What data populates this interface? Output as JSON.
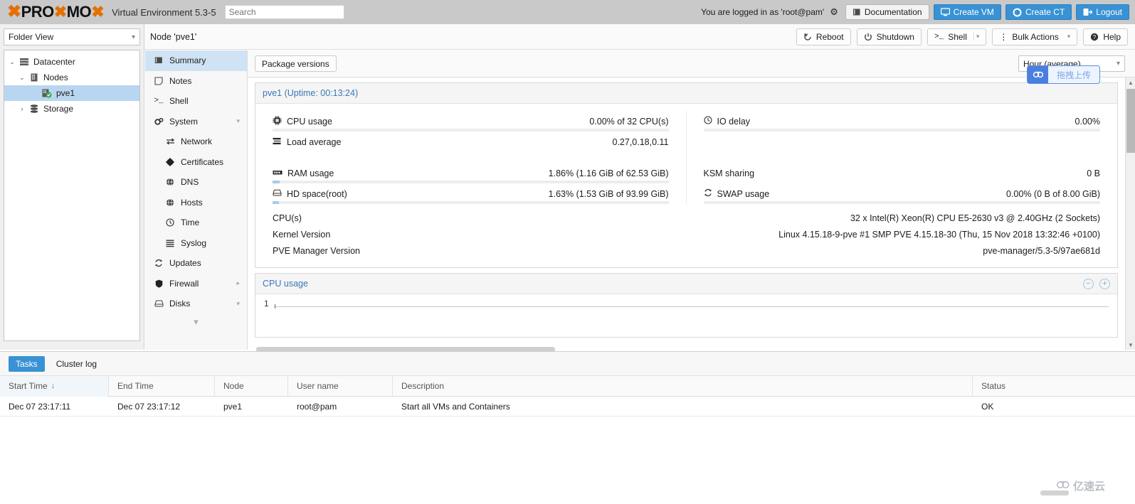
{
  "header": {
    "brand": "PROXMOX",
    "product": "Virtual Environment 5.3-5",
    "search_placeholder": "Search",
    "search_value": "",
    "login_text": "You are logged in as 'root@pam'",
    "gear_icon": "gear-icon",
    "buttons": [
      {
        "label": "Documentation",
        "icon": "book-icon",
        "style": "light"
      },
      {
        "label": "Create VM",
        "icon": "monitor-icon",
        "style": "blue"
      },
      {
        "label": "Create CT",
        "icon": "container-icon",
        "style": "blue"
      },
      {
        "label": "Logout",
        "icon": "logout-icon",
        "style": "blue"
      }
    ]
  },
  "node_toolbar": {
    "title": "Node 'pve1'",
    "buttons": [
      {
        "label": "Reboot",
        "icon": "reboot-icon",
        "caret": false
      },
      {
        "label": "Shutdown",
        "icon": "power-icon",
        "caret": false
      },
      {
        "label": "Shell",
        "icon": "terminal-icon",
        "caret": true
      },
      {
        "label": "Bulk Actions",
        "icon": "vertical-dots-icon",
        "caret": true
      },
      {
        "label": "Help",
        "icon": "help-icon",
        "caret": false
      }
    ]
  },
  "sidebar": {
    "view_selector": "Folder View",
    "tree": [
      {
        "label": "Datacenter",
        "icon": "datacenter-icon",
        "indent": 0,
        "expander": "⌄",
        "selected": false
      },
      {
        "label": "Nodes",
        "icon": "nodes-icon",
        "indent": 1,
        "expander": "⌄",
        "selected": false
      },
      {
        "label": "pve1",
        "icon": "node-online-icon",
        "indent": 2,
        "expander": "",
        "selected": true
      },
      {
        "label": "Storage",
        "icon": "storage-icon",
        "indent": 1,
        "expander": "›",
        "selected": false
      }
    ]
  },
  "navmenu": {
    "items": [
      {
        "label": "Summary",
        "icon": "summary-icon",
        "sub": false,
        "arrow": "",
        "selected": true
      },
      {
        "label": "Notes",
        "icon": "notes-icon",
        "sub": false,
        "arrow": "",
        "selected": false
      },
      {
        "label": "Shell",
        "icon": "shell-icon",
        "sub": false,
        "arrow": "",
        "selected": false
      },
      {
        "label": "System",
        "icon": "system-icon",
        "sub": false,
        "arrow": "▾",
        "selected": false
      },
      {
        "label": "Network",
        "icon": "network-icon",
        "sub": true,
        "arrow": "",
        "selected": false
      },
      {
        "label": "Certificates",
        "icon": "certificate-icon",
        "sub": true,
        "arrow": "",
        "selected": false
      },
      {
        "label": "DNS",
        "icon": "dns-icon",
        "sub": true,
        "arrow": "",
        "selected": false
      },
      {
        "label": "Hosts",
        "icon": "hosts-icon",
        "sub": true,
        "arrow": "",
        "selected": false
      },
      {
        "label": "Time",
        "icon": "clock-icon",
        "sub": true,
        "arrow": "",
        "selected": false
      },
      {
        "label": "Syslog",
        "icon": "syslog-icon",
        "sub": true,
        "arrow": "",
        "selected": false
      },
      {
        "label": "Updates",
        "icon": "updates-icon",
        "sub": false,
        "arrow": "",
        "selected": false
      },
      {
        "label": "Firewall",
        "icon": "firewall-icon",
        "sub": false,
        "arrow": "▸",
        "selected": false
      },
      {
        "label": "Disks",
        "icon": "disks-icon",
        "sub": false,
        "arrow": "▾",
        "selected": false
      }
    ],
    "more_icon": "chevron-down-icon"
  },
  "main": {
    "package_versions_label": "Package versions",
    "time_range": "Hour (average)",
    "summary_panel_title": "pve1 (Uptime: 00:13:24)",
    "stats_left": [
      {
        "label": "CPU usage",
        "icon": "cpu-icon",
        "value": "0.00% of 32 CPU(s)",
        "bar_pct": 0,
        "has_bar": true
      },
      {
        "label": "Load average",
        "icon": "load-icon",
        "value": "0.27,0.18,0.11",
        "bar_pct": null,
        "has_bar": false
      },
      {
        "label": "RAM usage",
        "icon": "ram-icon",
        "value": "1.86% (1.16 GiB of 62.53 GiB)",
        "bar_pct": 1.86,
        "has_bar": true
      },
      {
        "label": "HD space(root)",
        "icon": "hd-icon",
        "value": "1.63% (1.53 GiB of 93.99 GiB)",
        "bar_pct": 1.63,
        "has_bar": true
      }
    ],
    "stats_right": [
      {
        "label": "IO delay",
        "icon": "iodelay-icon",
        "value": "0.00%",
        "bar_pct": 0,
        "has_bar": true
      },
      {
        "label": "KSM sharing",
        "icon": "",
        "value": "0 B",
        "bar_pct": null,
        "has_bar": false
      },
      {
        "label": "SWAP usage",
        "icon": "swap-icon",
        "value": "0.00% (0 B of 8.00 GiB)",
        "bar_pct": 0,
        "has_bar": true
      }
    ],
    "info_rows": [
      {
        "label": "CPU(s)",
        "value": "32 x Intel(R) Xeon(R) CPU E5-2630 v3 @ 2.40GHz (2 Sockets)"
      },
      {
        "label": "Kernel Version",
        "value": "Linux 4.15.18-9-pve #1 SMP PVE 4.15.18-30 (Thu, 15 Nov 2018 13:32:46 +0100)"
      },
      {
        "label": "PVE Manager Version",
        "value": "pve-manager/5.3-5/97ae681d"
      }
    ],
    "cpu_chart": {
      "title": "CPU usage",
      "y_top_label": "1",
      "zoom_out_icon": "minus-circle-icon",
      "zoom_in_icon": "plus-circle-icon"
    }
  },
  "upload_widget": {
    "label": "拖拽上传",
    "icon": "cloud-upload-icon"
  },
  "bottom": {
    "tabs": [
      {
        "label": "Tasks",
        "active": true
      },
      {
        "label": "Cluster log",
        "active": false
      }
    ],
    "columns": [
      "Start Time",
      "End Time",
      "Node",
      "User name",
      "Description",
      "Status"
    ],
    "sorted_column": 0,
    "sort_arrow": "↓",
    "rows": [
      {
        "start_time": "Dec 07 23:17:11",
        "end_time": "Dec 07 23:17:12",
        "node": "pve1",
        "user_name": "root@pam",
        "description": "Start all VMs and Containers",
        "status": "OK"
      }
    ]
  },
  "watermark": {
    "text": "亿速云",
    "icon": "cloud-icon"
  },
  "colors": {
    "accent_blue": "#3892d4",
    "brand_orange": "#e57000",
    "selection_blue": "#b8d6f0",
    "nav_selection": "#cfe3f5",
    "bar_fill": "#aacbe8"
  }
}
